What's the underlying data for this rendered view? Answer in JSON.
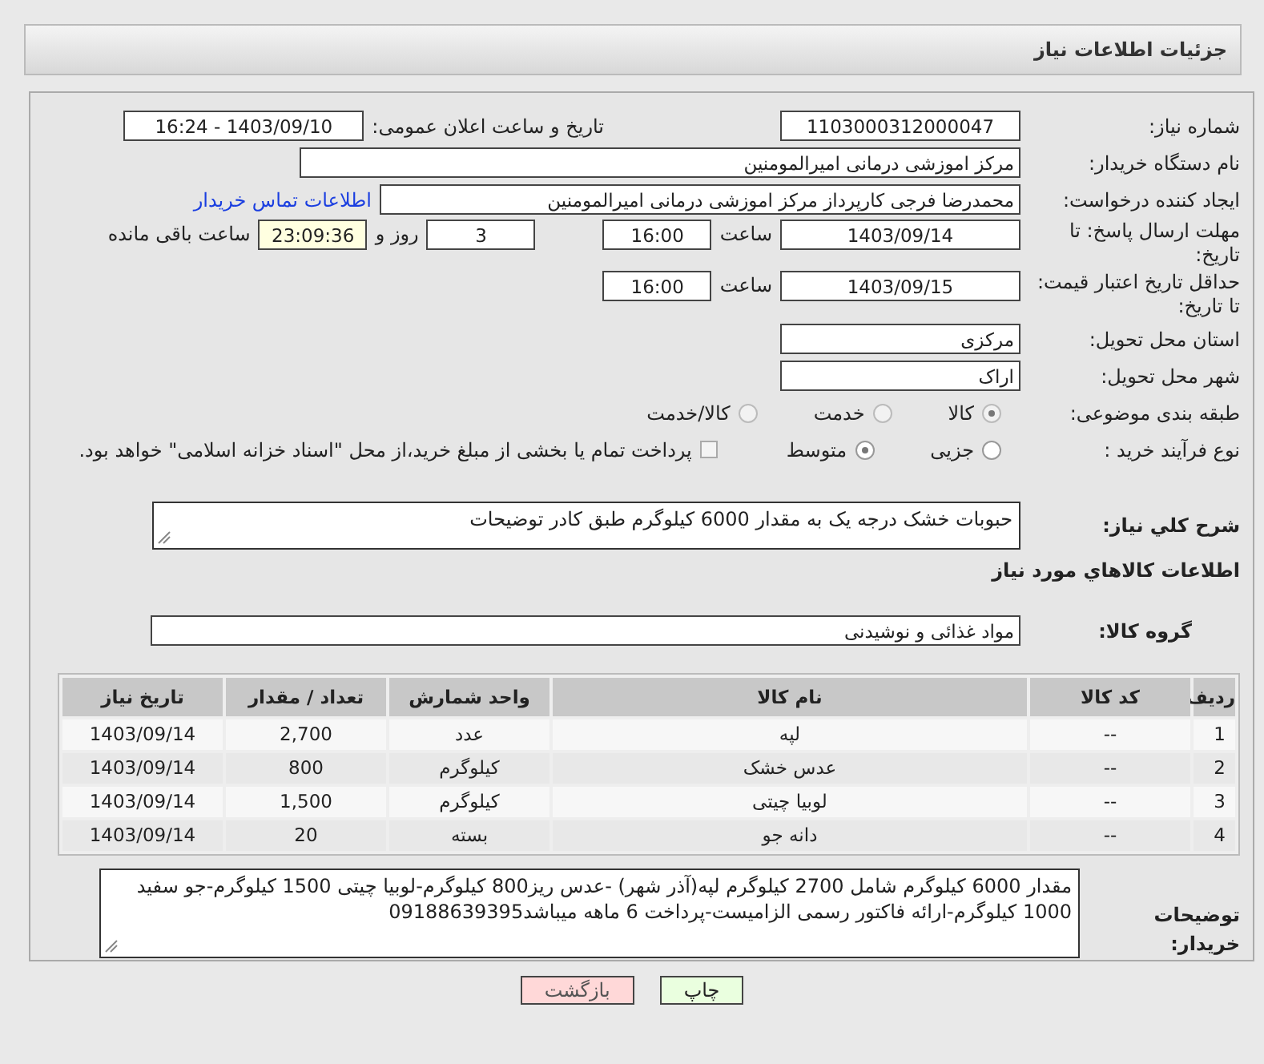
{
  "header": {
    "title": "جزئیات اطلاعات نیاز"
  },
  "need_number": {
    "label": "شماره نیاز:",
    "value": "1103000312000047"
  },
  "announce": {
    "label": "تاریخ و ساعت اعلان عمومی:",
    "value": "1403/09/10 - 16:24"
  },
  "buyer_org": {
    "label": "نام دستگاه خریدار:",
    "value": "مرکز اموزشی درمانی امیرالمومنین"
  },
  "requester": {
    "label": "ایجاد کننده درخواست:",
    "value": "محمدرضا فرجی کارپرداز مرکز اموزشی درمانی امیرالمومنین",
    "link": "اطلاعات تماس خریدار"
  },
  "response_deadline": {
    "label": "مهلت ارسال پاسخ: تا تاریخ:",
    "date": "1403/09/14",
    "time_label": "ساعت",
    "time": "16:00",
    "days": "3",
    "days_label": "روز و",
    "remaining": "23:09:36",
    "remaining_label": "ساعت باقی مانده"
  },
  "price_validity": {
    "label": "حداقل تاریخ اعتبار قیمت: تا تاریخ:",
    "date": "1403/09/15",
    "time_label": "ساعت",
    "time": "16:00"
  },
  "province": {
    "label": "استان محل تحویل:",
    "value": "مرکزی"
  },
  "city": {
    "label": "شهر محل تحویل:",
    "value": "اراک"
  },
  "category": {
    "label": "طبقه بندی موضوعی:",
    "options": [
      {
        "label": "کالا",
        "selected": true
      },
      {
        "label": "خدمت",
        "selected": false
      },
      {
        "label": "کالا/خدمت",
        "selected": false
      }
    ]
  },
  "process": {
    "label": "نوع فرآیند خرید :",
    "options": [
      {
        "label": "جزیی",
        "selected": false
      },
      {
        "label": "متوسط",
        "selected": true
      }
    ],
    "payment": {
      "label": "پرداخت تمام یا بخشی از مبلغ خرید،از محل \"اسناد خزانه اسلامی\" خواهد بود.",
      "checked": false
    }
  },
  "summary": {
    "label": "شرح کلي نیاز:",
    "value": "حبوبات خشک درجه یک به مقدار 6000 کیلوگرم طبق کادر توضیحات"
  },
  "goods_title": "اطلاعات کالاهاي مورد نیاز",
  "goods_group": {
    "label": "گروه کالا:",
    "value": "مواد غذائی و نوشیدنی"
  },
  "table": {
    "columns": [
      "ردیف",
      "کد کالا",
      "نام کالا",
      "واحد شمارش",
      "تعداد / مقدار",
      "تاریخ نیاز"
    ],
    "rows": [
      [
        "1",
        "--",
        "لپه",
        "عدد",
        "2,700",
        "1403/09/14"
      ],
      [
        "2",
        "--",
        "عدس خشک",
        "کیلوگرم",
        "800",
        "1403/09/14"
      ],
      [
        "3",
        "--",
        "لوبیا چیتی",
        "کیلوگرم",
        "1,500",
        "1403/09/14"
      ],
      [
        "4",
        "--",
        "دانه جو",
        "بسته",
        "20",
        "1403/09/14"
      ]
    ]
  },
  "buyer_notes": {
    "label": "توضیحات خریدار:",
    "value": "مقدار 6000 کیلوگرم شامل 2700 کیلوگرم لپه(آذر شهر) -عدس ریز800 کیلوگرم-لوبیا چیتی 1500 کیلوگرم-جو سفید 1000 کیلوگرم-ارائه فاکتور رسمی الزامیست-پرداخت 6 ماهه میباشد09188639395"
  },
  "buttons": [
    {
      "label": "چاپ",
      "kind": "print"
    },
    {
      "label": "بازگشت",
      "kind": "back"
    }
  ]
}
